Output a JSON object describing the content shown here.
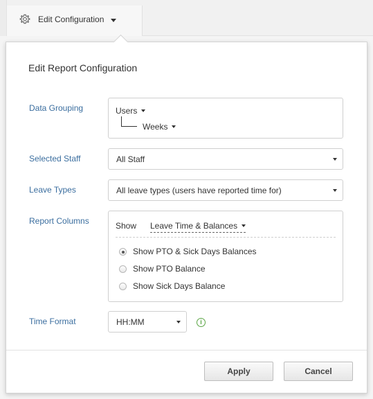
{
  "toolbar": {
    "title": "Edit Configuration",
    "icon": "gear-icon"
  },
  "dialog": {
    "title": "Edit Report Configuration",
    "data_grouping": {
      "label": "Data Grouping",
      "level1": "Users",
      "level2": "Weeks"
    },
    "selected_staff": {
      "label": "Selected Staff",
      "value": "All Staff"
    },
    "leave_types": {
      "label": "Leave Types",
      "value": "All leave types (users have reported time for)"
    },
    "report_columns": {
      "label": "Report Columns",
      "show_label": "Show",
      "show_value": "Leave Time & Balances",
      "options": [
        {
          "label": "Show PTO & Sick Days Balances",
          "checked": true
        },
        {
          "label": "Show PTO Balance",
          "checked": false
        },
        {
          "label": "Show Sick Days Balance",
          "checked": false
        }
      ]
    },
    "time_format": {
      "label": "Time Format",
      "value": "HH:MM",
      "info_icon": "info-icon"
    },
    "buttons": {
      "apply": "Apply",
      "cancel": "Cancel"
    }
  },
  "colors": {
    "label": "#3b6e9f",
    "info": "#5aa544"
  }
}
